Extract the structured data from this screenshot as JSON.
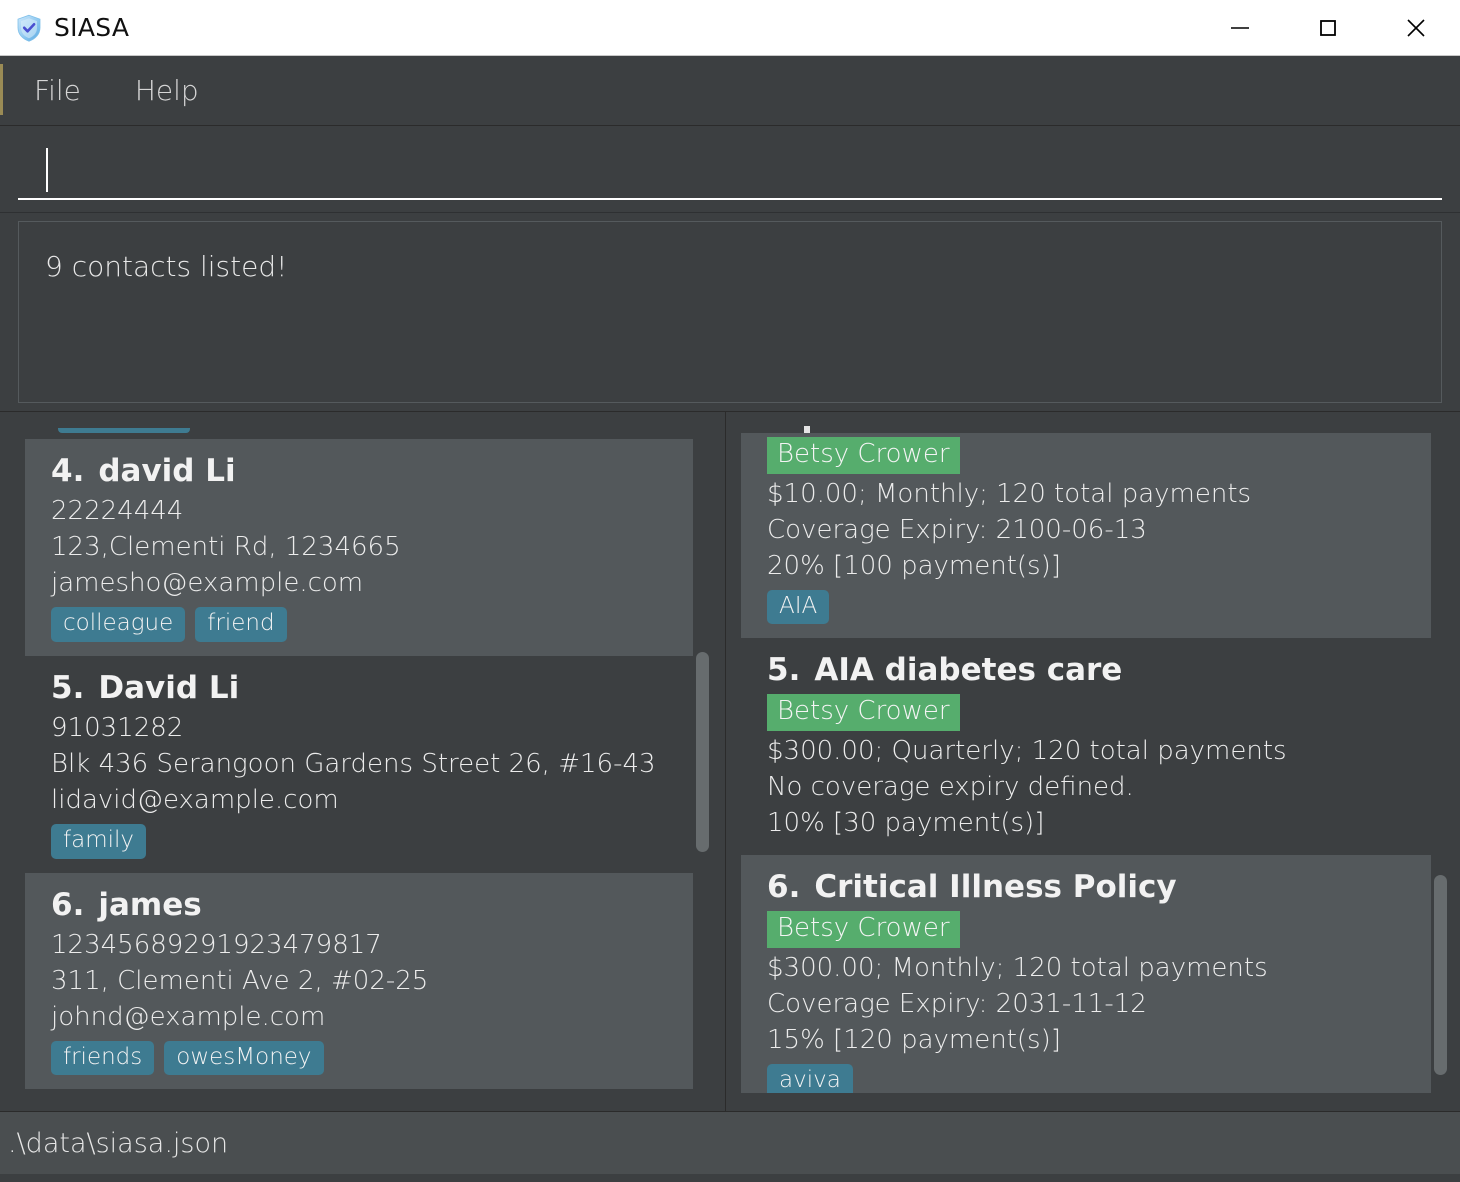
{
  "window": {
    "title": "SIASA",
    "icon": "shield-check-icon",
    "controls": {
      "minimize": "minimize-icon",
      "maximize": "maximize-icon",
      "close": "close-icon"
    }
  },
  "menubar": {
    "items": [
      {
        "label": "File"
      },
      {
        "label": "Help"
      }
    ]
  },
  "command_box": {
    "value": "",
    "placeholder": ""
  },
  "result_display": {
    "text": "9 contacts listed!"
  },
  "colors": {
    "tag_chip": "#3e7b91",
    "owner_chip": "#56ad6d",
    "card_alt_bg": "#53585b",
    "card_bg": "#3c3f41",
    "panel_bg": "#3c3f41",
    "statusbar_bg": "#4a4e50",
    "menu_accent": "#9a8b55"
  },
  "contacts_panel": {
    "cards": [
      {
        "index": "4.",
        "name": "david Li",
        "phone": "22224444",
        "address": "123,Clementi Rd, 1234665",
        "email": "jamesho@example.com",
        "tags": [
          "colleague",
          "friend"
        ],
        "highlight": true
      },
      {
        "index": "5.",
        "name": "David Li",
        "phone": "91031282",
        "address": "Blk 436 Serangoon Gardens Street 26, #16-43",
        "email": "lidavid@example.com",
        "tags": [
          "family"
        ],
        "highlight": false
      },
      {
        "index": "6.",
        "name": "james",
        "phone": "12345689291923479817",
        "address": "311, Clementi Ave 2, #02-25",
        "email": "johnd@example.com",
        "tags": [
          "friends",
          "owesMoney"
        ],
        "highlight": true
      }
    ]
  },
  "policies_panel": {
    "cards": [
      {
        "index": "",
        "title": "",
        "owner": "Betsy Crower",
        "premium": "$10.00; Monthly; 120 total payments",
        "expiry": "Coverage Expiry: 2100-06-13",
        "progress": "20% [100 payment(s)]",
        "tags": [
          "AIA"
        ],
        "highlight": true,
        "partial": true
      },
      {
        "index": "5.",
        "title": "AIA diabetes care",
        "owner": "Betsy Crower",
        "premium": "$300.00; Quarterly; 120 total payments",
        "expiry": "No coverage expiry defined.",
        "progress": "10% [30 payment(s)]",
        "tags": [],
        "highlight": false,
        "partial": false
      },
      {
        "index": "6.",
        "title": "Critical Illness Policy",
        "owner": "Betsy Crower",
        "premium": "$300.00; Monthly; 120 total payments",
        "expiry": "Coverage Expiry: 2031-11-12",
        "progress": "15% [120 payment(s)]",
        "tags": [
          "aviva"
        ],
        "highlight": true,
        "partial": false
      }
    ]
  },
  "statusbar": {
    "path": ".\\data\\siasa.json"
  }
}
